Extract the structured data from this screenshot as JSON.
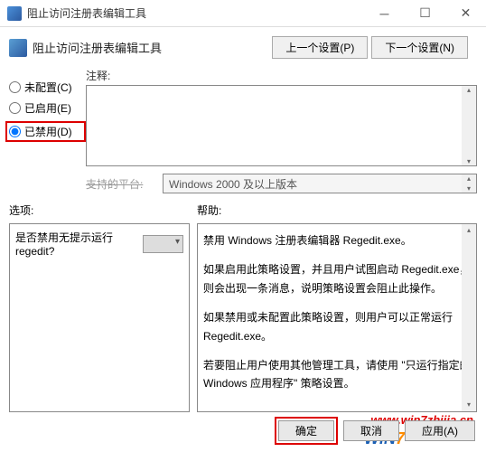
{
  "titlebar": {
    "title": "阻止访问注册表编辑工具"
  },
  "toolbar": {
    "title": "阻止访问注册表编辑工具",
    "prev_btn": "上一个设置(P)",
    "next_btn": "下一个设置(N)"
  },
  "radios": {
    "not_configured": "未配置(C)",
    "enabled": "已启用(E)",
    "disabled": "已禁用(D)"
  },
  "comment": {
    "label": "注释:"
  },
  "platform": {
    "label": "支持的平台:",
    "value": "Windows 2000 及以上版本"
  },
  "options": {
    "label": "选项:",
    "question": "是否禁用无提示运行 regedit?"
  },
  "help": {
    "label": "帮助:",
    "p1": "禁用 Windows 注册表编辑器 Regedit.exe。",
    "p2": "如果启用此策略设置，并且用户试图启动 Regedit.exe，则会出现一条消息，说明策略设置会阻止此操作。",
    "p3": "如果禁用或未配置此策略设置，则用户可以正常运行 Regedit.exe。",
    "p4": "若要阻止用户使用其他管理工具，请使用 \"只运行指定的 Windows 应用程序\" 策略设置。"
  },
  "footer": {
    "ok": "确定",
    "cancel": "取消",
    "apply": "应用(A)"
  },
  "watermark": {
    "url": "www.win7zhijia.cn"
  }
}
